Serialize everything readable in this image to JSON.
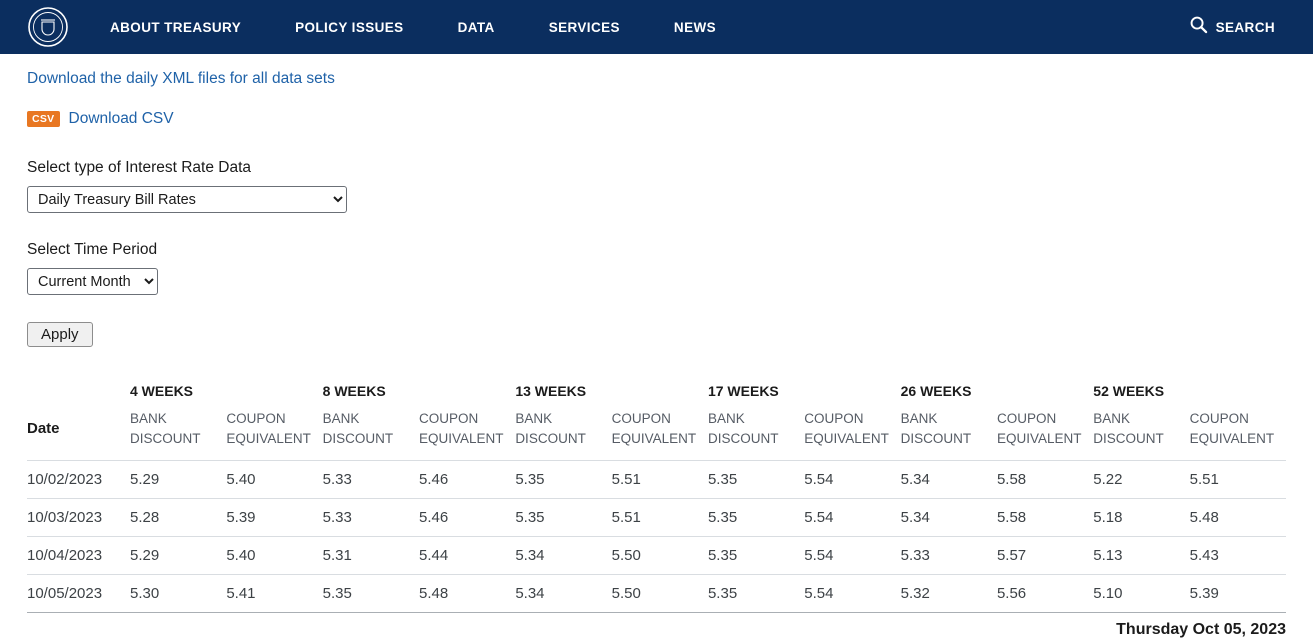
{
  "colors": {
    "header_bg": "#0b2e5f",
    "link": "#1f62a8",
    "csv_badge_bg": "#e87722"
  },
  "nav": {
    "items": [
      "ABOUT TREASURY",
      "POLICY ISSUES",
      "DATA",
      "SERVICES",
      "NEWS"
    ],
    "search_label": "SEARCH"
  },
  "controls": {
    "xml_link": "Download the daily XML files for all data sets",
    "csv_badge": "CSV",
    "csv_link": "Download CSV",
    "rate_type_label": "Select type of Interest Rate Data",
    "rate_type_value": "Daily Treasury Bill Rates",
    "time_period_label": "Select Time Period",
    "time_period_value": "Current Month",
    "apply_label": "Apply"
  },
  "table": {
    "date_header": "Date",
    "groups": [
      "4 WEEKS",
      "8 WEEKS",
      "13 WEEKS",
      "17 WEEKS",
      "26 WEEKS",
      "52 WEEKS"
    ],
    "subheaders": [
      "BANK DISCOUNT",
      "COUPON EQUIVALENT"
    ],
    "rows": [
      {
        "date": "10/02/2023",
        "values": [
          "5.29",
          "5.40",
          "5.33",
          "5.46",
          "5.35",
          "5.51",
          "5.35",
          "5.54",
          "5.34",
          "5.58",
          "5.22",
          "5.51"
        ]
      },
      {
        "date": "10/03/2023",
        "values": [
          "5.28",
          "5.39",
          "5.33",
          "5.46",
          "5.35",
          "5.51",
          "5.35",
          "5.54",
          "5.34",
          "5.58",
          "5.18",
          "5.48"
        ]
      },
      {
        "date": "10/04/2023",
        "values": [
          "5.29",
          "5.40",
          "5.31",
          "5.44",
          "5.34",
          "5.50",
          "5.35",
          "5.54",
          "5.33",
          "5.57",
          "5.13",
          "5.43"
        ]
      },
      {
        "date": "10/05/2023",
        "values": [
          "5.30",
          "5.41",
          "5.35",
          "5.48",
          "5.34",
          "5.50",
          "5.35",
          "5.54",
          "5.32",
          "5.56",
          "5.10",
          "5.39"
        ]
      }
    ],
    "footer_date": "Thursday Oct 05, 2023"
  }
}
